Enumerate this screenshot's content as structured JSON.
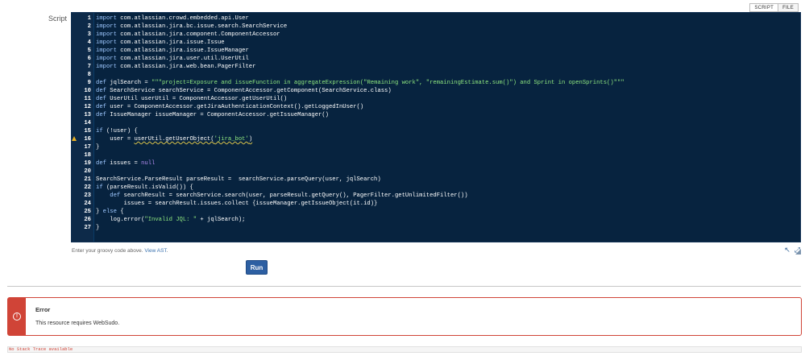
{
  "toggle": {
    "script_label": "SCRIPT",
    "file_label": "FILE"
  },
  "script_label": "Script",
  "editor": {
    "warning_line": 16,
    "lines": [
      {
        "n": "1",
        "code": "<span class=\"kw\">import</span> com.atlassian.crowd.embedded.api.User"
      },
      {
        "n": "2",
        "code": "<span class=\"kw\">import</span> com.atlassian.jira.bc.issue.search.SearchService"
      },
      {
        "n": "3",
        "code": "<span class=\"kw\">import</span> com.atlassian.jira.component.ComponentAccessor"
      },
      {
        "n": "4",
        "code": "<span class=\"kw\">import</span> com.atlassian.jira.issue.Issue"
      },
      {
        "n": "5",
        "code": "<span class=\"kw\">import</span> com.atlassian.jira.issue.IssueManager"
      },
      {
        "n": "6",
        "code": "<span class=\"kw\">import</span> com.atlassian.jira.user.util.UserUtil"
      },
      {
        "n": "7",
        "code": "<span class=\"kw\">import</span> com.atlassian.jira.web.bean.PagerFilter"
      },
      {
        "n": "8",
        "code": ""
      },
      {
        "n": "9",
        "code": "<span class=\"kw\">def</span> jqlSearch = <span class=\"str\">\"\"\"project=Exposure and issueFunction in aggregateExpression(\"Remaining work\", \"remainingEstimate.sum()\") and Sprint in openSprints()\"\"\"</span>"
      },
      {
        "n": "10",
        "code": "<span class=\"kw\">def</span> SearchService searchService = ComponentAccessor.getComponent(SearchService.class)"
      },
      {
        "n": "11",
        "code": "<span class=\"kw\">def</span> UserUtil userUtil = ComponentAccessor.getUserUtil()"
      },
      {
        "n": "12",
        "code": "<span class=\"kw\">def</span> user = ComponentAccessor.getJiraAuthenticationContext().getLoggedInUser()"
      },
      {
        "n": "13",
        "code": "<span class=\"kw\">def</span> IssueManager issueManager = ComponentAccessor.getIssueManager()"
      },
      {
        "n": "14",
        "code": ""
      },
      {
        "n": "15",
        "code": "<span class=\"kw\">if</span> (!user) {"
      },
      {
        "n": "16",
        "code": "    user = <span class=\"squig\">userUtil.getUserObject(<span class=\"str\">'jira_bot'</span>)</span>"
      },
      {
        "n": "17",
        "code": "}"
      },
      {
        "n": "18",
        "code": ""
      },
      {
        "n": "19",
        "code": "<span class=\"kw\">def</span> issues = <span class=\"nul\">null</span>"
      },
      {
        "n": "20",
        "code": ""
      },
      {
        "n": "21",
        "code": "SearchService.ParseResult parseResult =  searchService.parseQuery(user, jqlSearch)"
      },
      {
        "n": "22",
        "code": "<span class=\"kw\">if</span> (parseResult.isValid()) {"
      },
      {
        "n": "23",
        "code": "    <span class=\"kw\">def</span> searchResult = searchService.search(user, parseResult.getQuery(), PagerFilter.getUnlimitedFilter())"
      },
      {
        "n": "24",
        "code": "        issues = searchResult.issues.collect {issueManager.getIssueObject(it.id)}"
      },
      {
        "n": "25",
        "code": "} <span class=\"kw\">else</span> {"
      },
      {
        "n": "26",
        "code": "    log.error(<span class=\"str\">\"Invalid JQL: \"</span> + jqlSearch);"
      },
      {
        "n": "27",
        "code": "}"
      }
    ]
  },
  "hint": {
    "prefix": "Enter your groovy code above. ",
    "link": "View AST",
    "suffix": "."
  },
  "run_label": "Run",
  "error": {
    "title": "Error",
    "message": "This resource requires WebSudo."
  },
  "stack_trace": "No Stack Trace available",
  "colors": {
    "accent": "#2d5fa2",
    "error": "#d04437",
    "editor_bg": "#07233f"
  }
}
